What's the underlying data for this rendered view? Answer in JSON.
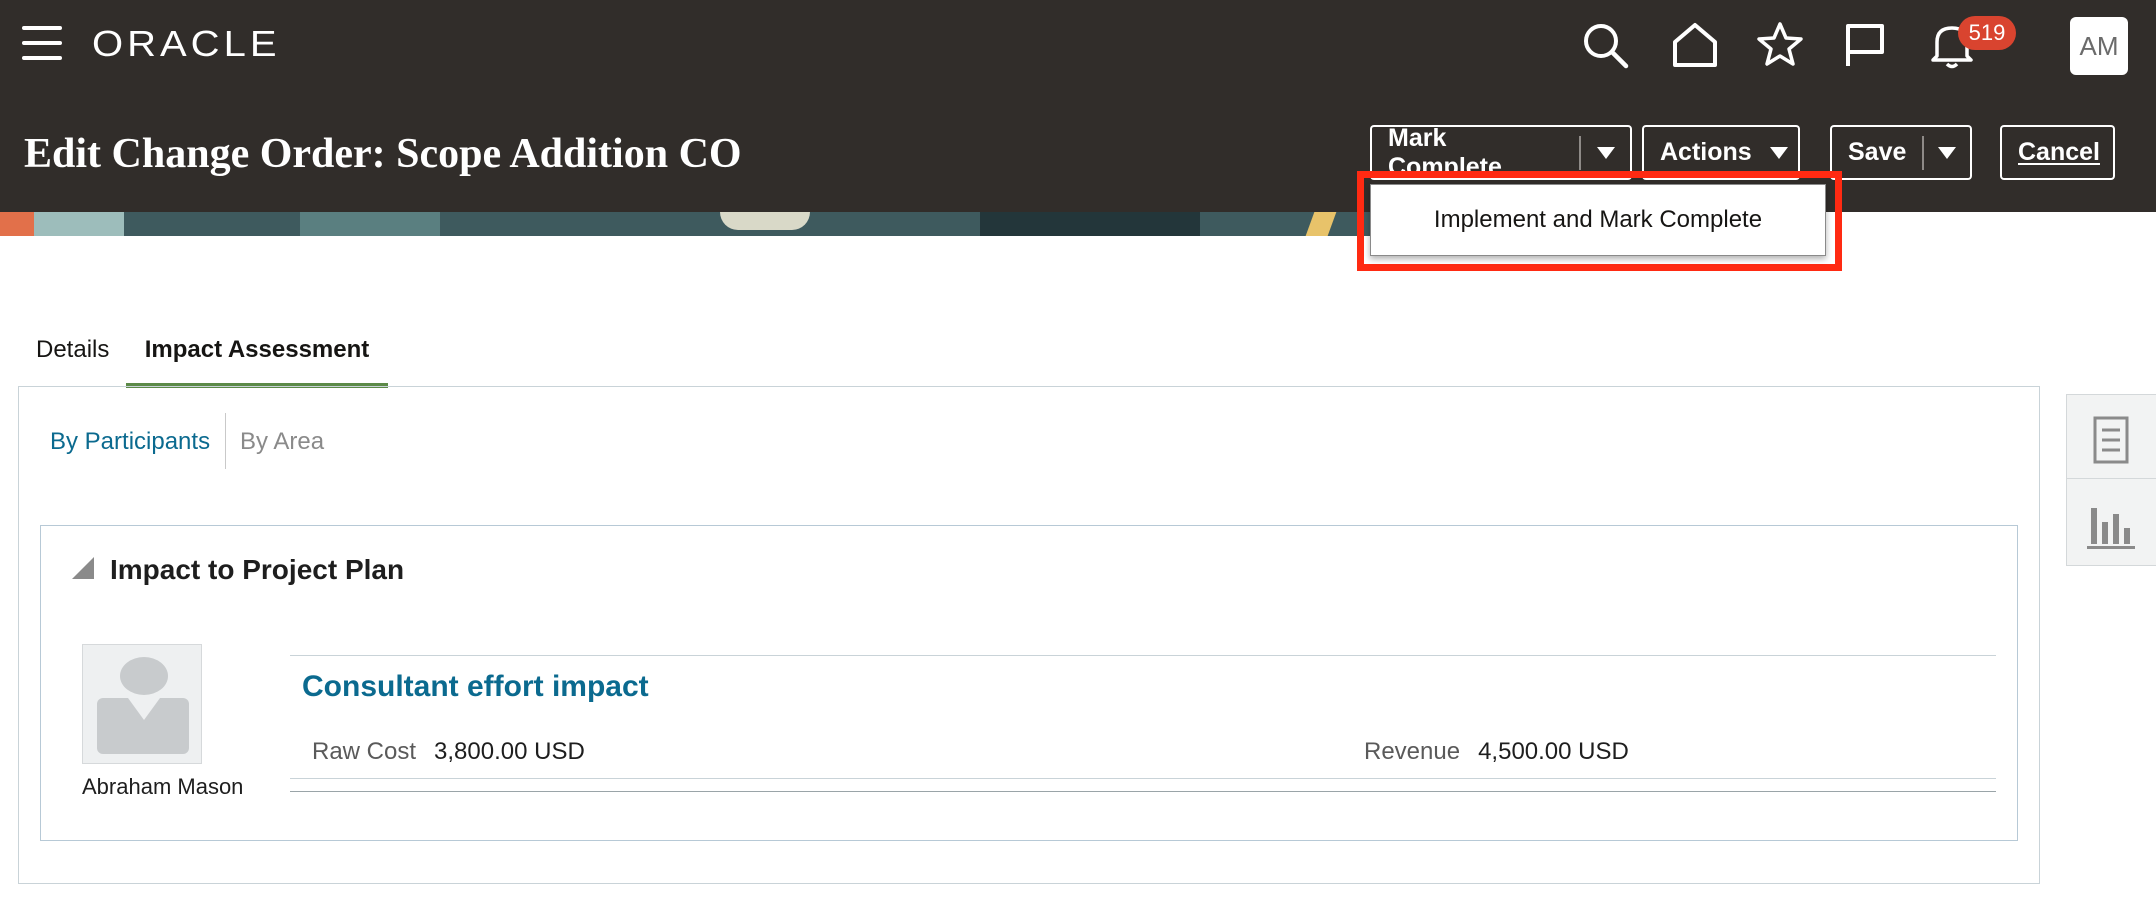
{
  "header": {
    "logo": "ORACLE",
    "notification_count": "519",
    "user_initials": "AM",
    "page_title": "Edit Change Order: Scope Addition CO"
  },
  "toolbar": {
    "mark_complete_label": "Mark Complete",
    "actions_label": "Actions",
    "save_label": "Save",
    "cancel_label": "Cancel"
  },
  "dropdown": {
    "items": [
      "Implement and Mark Complete"
    ],
    "highlight_color": "#ff2a12"
  },
  "tabs": [
    {
      "label": "Details",
      "active": false
    },
    {
      "label": "Impact Assessment",
      "active": true
    }
  ],
  "subnav": {
    "by_participants": "By Participants",
    "by_area": "By Area"
  },
  "section": {
    "title": "Impact to Project Plan",
    "participant": {
      "name": "Abraham Mason",
      "impact_title": "Consultant effort impact",
      "raw_cost_label": "Raw Cost",
      "raw_cost_value": "3,800.00",
      "raw_cost_currency": "USD",
      "revenue_label": "Revenue",
      "revenue_value": "4,500.00",
      "revenue_currency": "USD"
    }
  },
  "icons": {
    "top": [
      "hamburger-menu-icon",
      "search-icon",
      "home-icon",
      "favorites-star-icon",
      "flag-icon",
      "notifications-bell-icon"
    ],
    "rail": [
      "document-icon",
      "bar-chart-icon"
    ]
  },
  "colors": {
    "header_bg": "#312d2a",
    "link": "#0b6a8f",
    "active_tab_underline": "#5c8a48",
    "badge": "#d9442f"
  }
}
